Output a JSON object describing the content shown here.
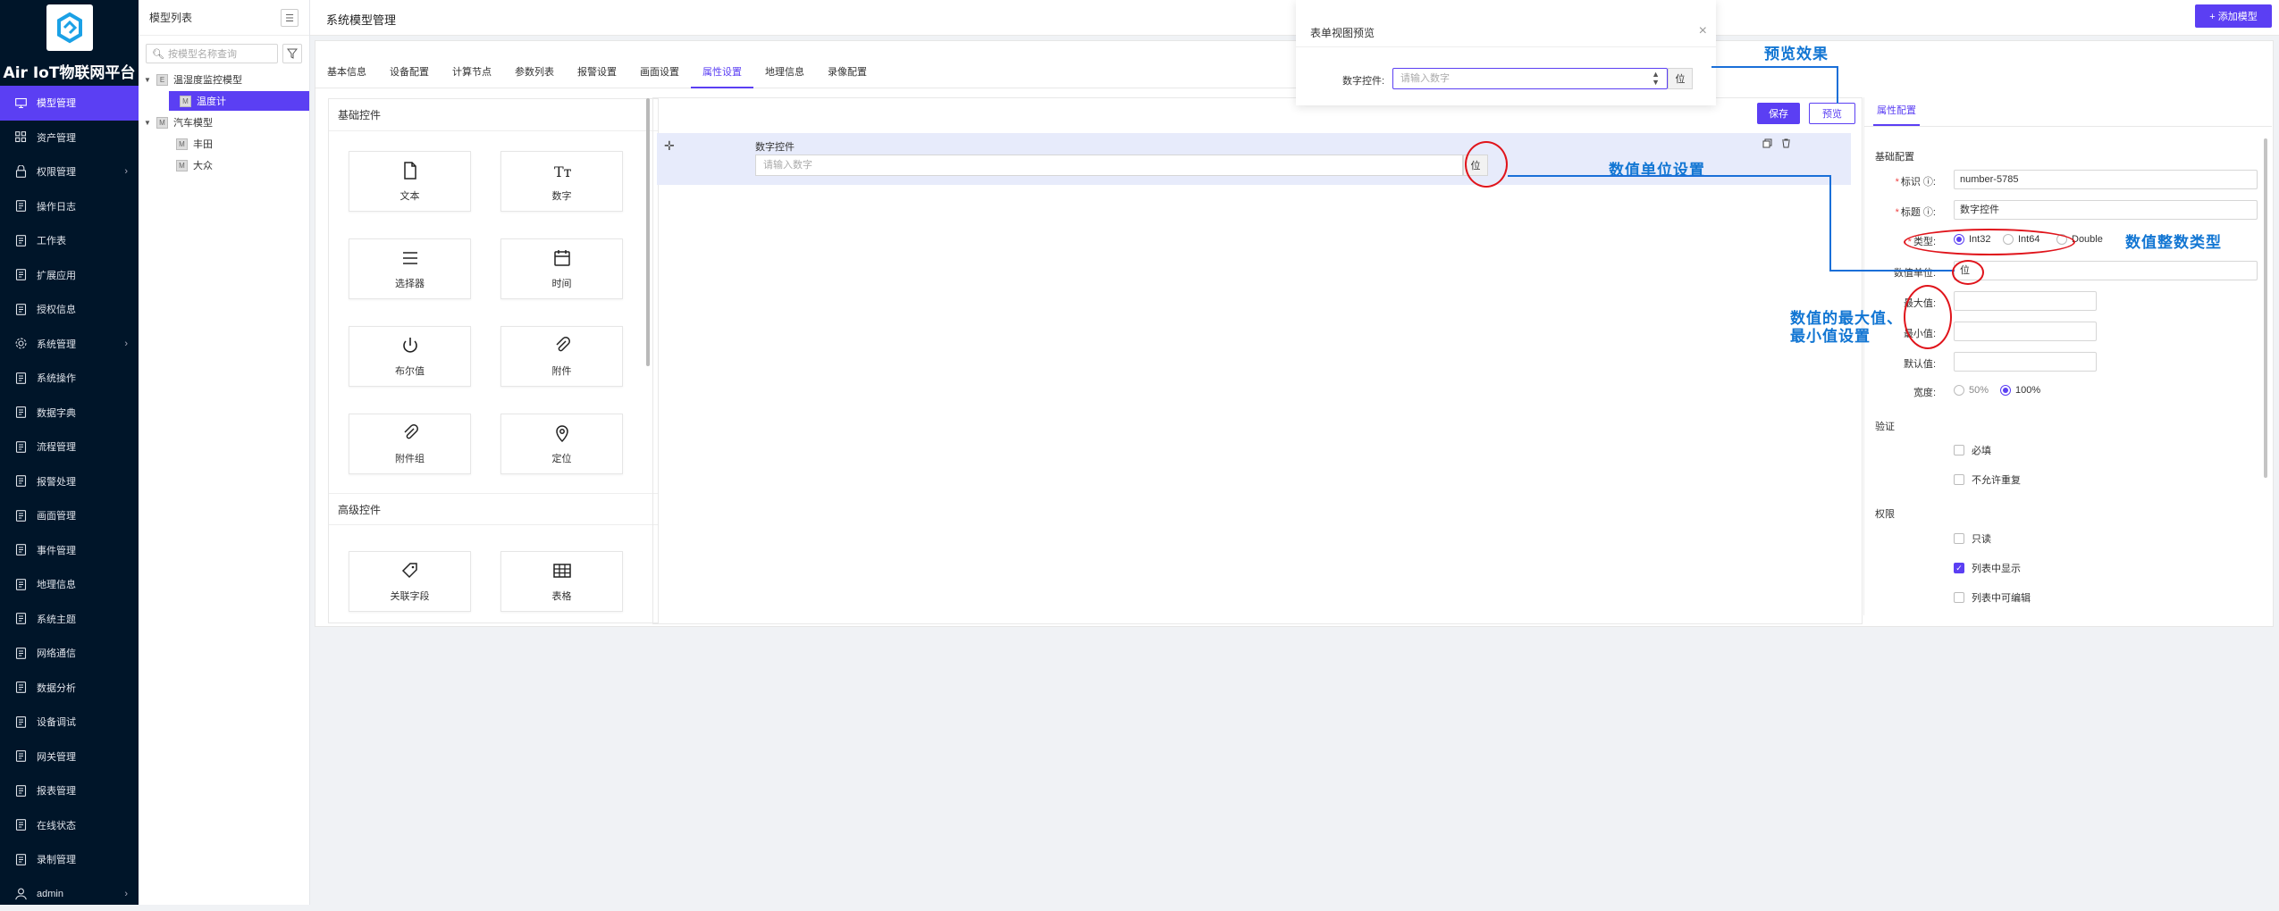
{
  "app": {
    "name": "Air IoT物联网平台"
  },
  "sidebar": {
    "items": [
      {
        "label": "模型管理",
        "icon": "monitor-icon",
        "active": true,
        "arrow": false
      },
      {
        "label": "资产管理",
        "icon": "grid-icon",
        "arrow": false
      },
      {
        "label": "权限管理",
        "icon": "lock-icon",
        "arrow": true
      },
      {
        "label": "操作日志",
        "icon": "log-icon",
        "arrow": false
      },
      {
        "label": "工作表",
        "icon": "sheet-icon",
        "arrow": false
      },
      {
        "label": "扩展应用",
        "icon": "app-icon",
        "arrow": false
      },
      {
        "label": "授权信息",
        "icon": "license-icon",
        "arrow": false
      },
      {
        "label": "系统管理",
        "icon": "gear-icon",
        "arrow": true
      },
      {
        "label": "系统操作",
        "icon": "ops-icon",
        "arrow": false
      },
      {
        "label": "数据字典",
        "icon": "dict-icon",
        "arrow": false
      },
      {
        "label": "流程管理",
        "icon": "flow-icon",
        "arrow": false
      },
      {
        "label": "报警处理",
        "icon": "alarm-icon",
        "arrow": false
      },
      {
        "label": "画面管理",
        "icon": "screen-icon",
        "arrow": false
      },
      {
        "label": "事件管理",
        "icon": "event-icon",
        "arrow": false
      },
      {
        "label": "地理信息",
        "icon": "map-icon",
        "arrow": false
      },
      {
        "label": "系统主题",
        "icon": "theme-icon",
        "arrow": false
      },
      {
        "label": "网络通信",
        "icon": "network-icon",
        "arrow": false
      },
      {
        "label": "数据分析",
        "icon": "analysis-icon",
        "arrow": false
      },
      {
        "label": "设备调试",
        "icon": "debug-icon",
        "arrow": false
      },
      {
        "label": "网关管理",
        "icon": "gateway-icon",
        "arrow": false
      },
      {
        "label": "报表管理",
        "icon": "report-icon",
        "arrow": false
      },
      {
        "label": "在线状态",
        "icon": "online-icon",
        "arrow": false
      },
      {
        "label": "录制管理",
        "icon": "record-icon",
        "arrow": false
      },
      {
        "label": "admin",
        "icon": "user-icon",
        "arrow": true
      }
    ]
  },
  "tree": {
    "title": "模型列表",
    "search_placeholder": "按模型名称查询",
    "nodes": [
      {
        "label": "温湿度监控模型",
        "depth": 0,
        "expanded": true
      },
      {
        "label": "温度计",
        "depth": 1,
        "selected": true
      },
      {
        "label": "汽车模型",
        "depth": 0,
        "expanded": true
      },
      {
        "label": "丰田",
        "depth": 1
      },
      {
        "label": "大众",
        "depth": 1
      }
    ]
  },
  "header": {
    "title": "系统模型管理",
    "add_button": "+ 添加模型"
  },
  "tabs": [
    "基本信息",
    "设备配置",
    "计算节点",
    "参数列表",
    "报警设置",
    "画面设置",
    "属性设置",
    "地理信息",
    "录像配置"
  ],
  "active_tab": "属性设置",
  "palette": {
    "basic_title": "基础控件",
    "basic": [
      {
        "label": "文本",
        "icon": "file-icon"
      },
      {
        "label": "数字",
        "icon": "number-text-icon"
      },
      {
        "label": "选择器",
        "icon": "list-icon"
      },
      {
        "label": "时间",
        "icon": "calendar-icon"
      },
      {
        "label": "布尔值",
        "icon": "power-icon"
      },
      {
        "label": "附件",
        "icon": "paperclip-icon"
      },
      {
        "label": "附件组",
        "icon": "paperclip-group-icon"
      },
      {
        "label": "定位",
        "icon": "location-pin-icon"
      }
    ],
    "advanced_title": "高级控件",
    "advanced": [
      {
        "label": "关联字段",
        "icon": "tag-icon"
      },
      {
        "label": "表格",
        "icon": "table-icon"
      }
    ]
  },
  "canvas": {
    "save": "保存",
    "preview": "预览",
    "field_label": "数字控件",
    "field_placeholder": "请输入数字",
    "field_unit": "位"
  },
  "properties": {
    "tab": "属性配置",
    "basic_section": "基础配置",
    "id_label": "标识",
    "id_value": "number-5785",
    "title_label": "标题",
    "title_value": "数字控件",
    "type_label": "类型",
    "type_options": [
      "Int32",
      "Int64",
      "Double"
    ],
    "type_selected": "Int32",
    "unit_label": "数值单位",
    "unit_value": "位",
    "max_label": "最大值",
    "min_label": "最小值",
    "default_label": "默认值",
    "width_label": "宽度",
    "width_options": [
      "50%",
      "100%"
    ],
    "width_selected": "100%",
    "validation_section": "验证",
    "required": "必填",
    "no_duplicate": "不允许重复",
    "permission_section": "权限",
    "readonly": "只读",
    "show_in_list": "列表中显示",
    "show_in_list_checked": true,
    "editable_in_list": "列表中可编辑"
  },
  "modal": {
    "title": "表单视图预览",
    "field_label": "数字控件:",
    "placeholder": "请输入数字",
    "unit": "位"
  },
  "annotations": {
    "preview_effect": "预览效果",
    "unit_setting": "数值单位设置",
    "int_type": "数值整数类型",
    "minmax_line1": "数值的最大值、",
    "minmax_line2": "最小值设置"
  },
  "colors": {
    "accent": "#5b3ff3",
    "sidebar_bg": "#001529",
    "annotation_text": "#1276d3",
    "annotation_ellipse": "#e0141b"
  }
}
